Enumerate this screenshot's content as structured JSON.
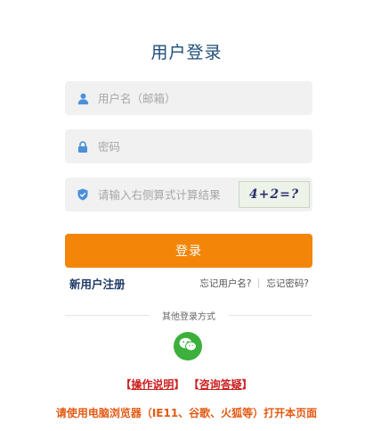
{
  "title": "用户登录",
  "username": {
    "placeholder": "用户名（邮箱）",
    "icon": "user-icon"
  },
  "password": {
    "placeholder": "密码",
    "icon": "lock-icon"
  },
  "captcha": {
    "placeholder": "请输入右侧算式计算结果",
    "icon": "shield-check-icon",
    "image_text": "4+2=?"
  },
  "login_button": "登录",
  "register_link": "新用户注册",
  "forgot_username": "忘记用户名?",
  "forgot_password": "忘记密码?",
  "other_login": "其他登录方式",
  "wechat_icon": "wechat-icon",
  "help": {
    "bracket_open": "【",
    "bracket_close": "】",
    "manual": "操作说明",
    "faq": "咨询答疑"
  },
  "notice": "请使用电脑浏览器（IE11、谷歌、火狐等）打开本页面",
  "colors": {
    "accent": "#f38508",
    "title": "#1f4e79",
    "link": "#1f3a66",
    "help": "#cc1f1f",
    "notice": "#e35a14",
    "wechat": "#3bb03b"
  }
}
